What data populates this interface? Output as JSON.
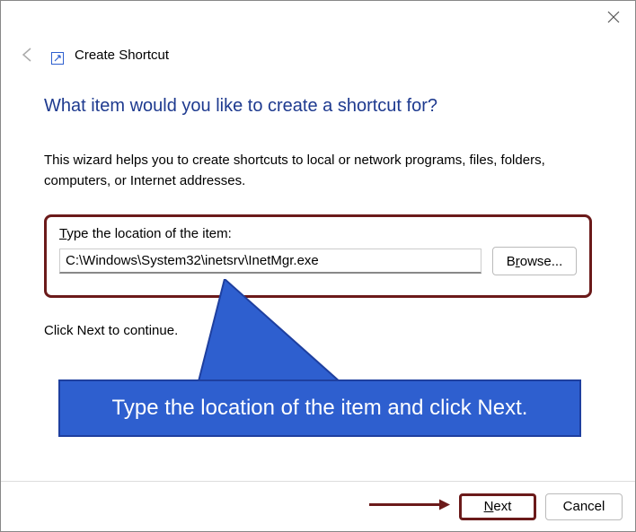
{
  "header": {
    "title": "Create Shortcut"
  },
  "main": {
    "heading": "What item would you like to create a shortcut for?",
    "description": "This wizard helps you to create shortcuts to local or network programs, files, folders, computers, or Internet addresses.",
    "field_label_pre": "",
    "field_label_u": "T",
    "field_label_post": "ype the location of the item:",
    "location_value": "C:\\Windows\\System32\\inetsrv\\InetMgr.exe",
    "browse_pre": "B",
    "browse_u": "r",
    "browse_post": "owse...",
    "continue_text": "Click Next to continue."
  },
  "annotation": {
    "text": "Type the location of the item and click Next."
  },
  "footer": {
    "next_u": "N",
    "next_post": "ext",
    "cancel": "Cancel"
  }
}
